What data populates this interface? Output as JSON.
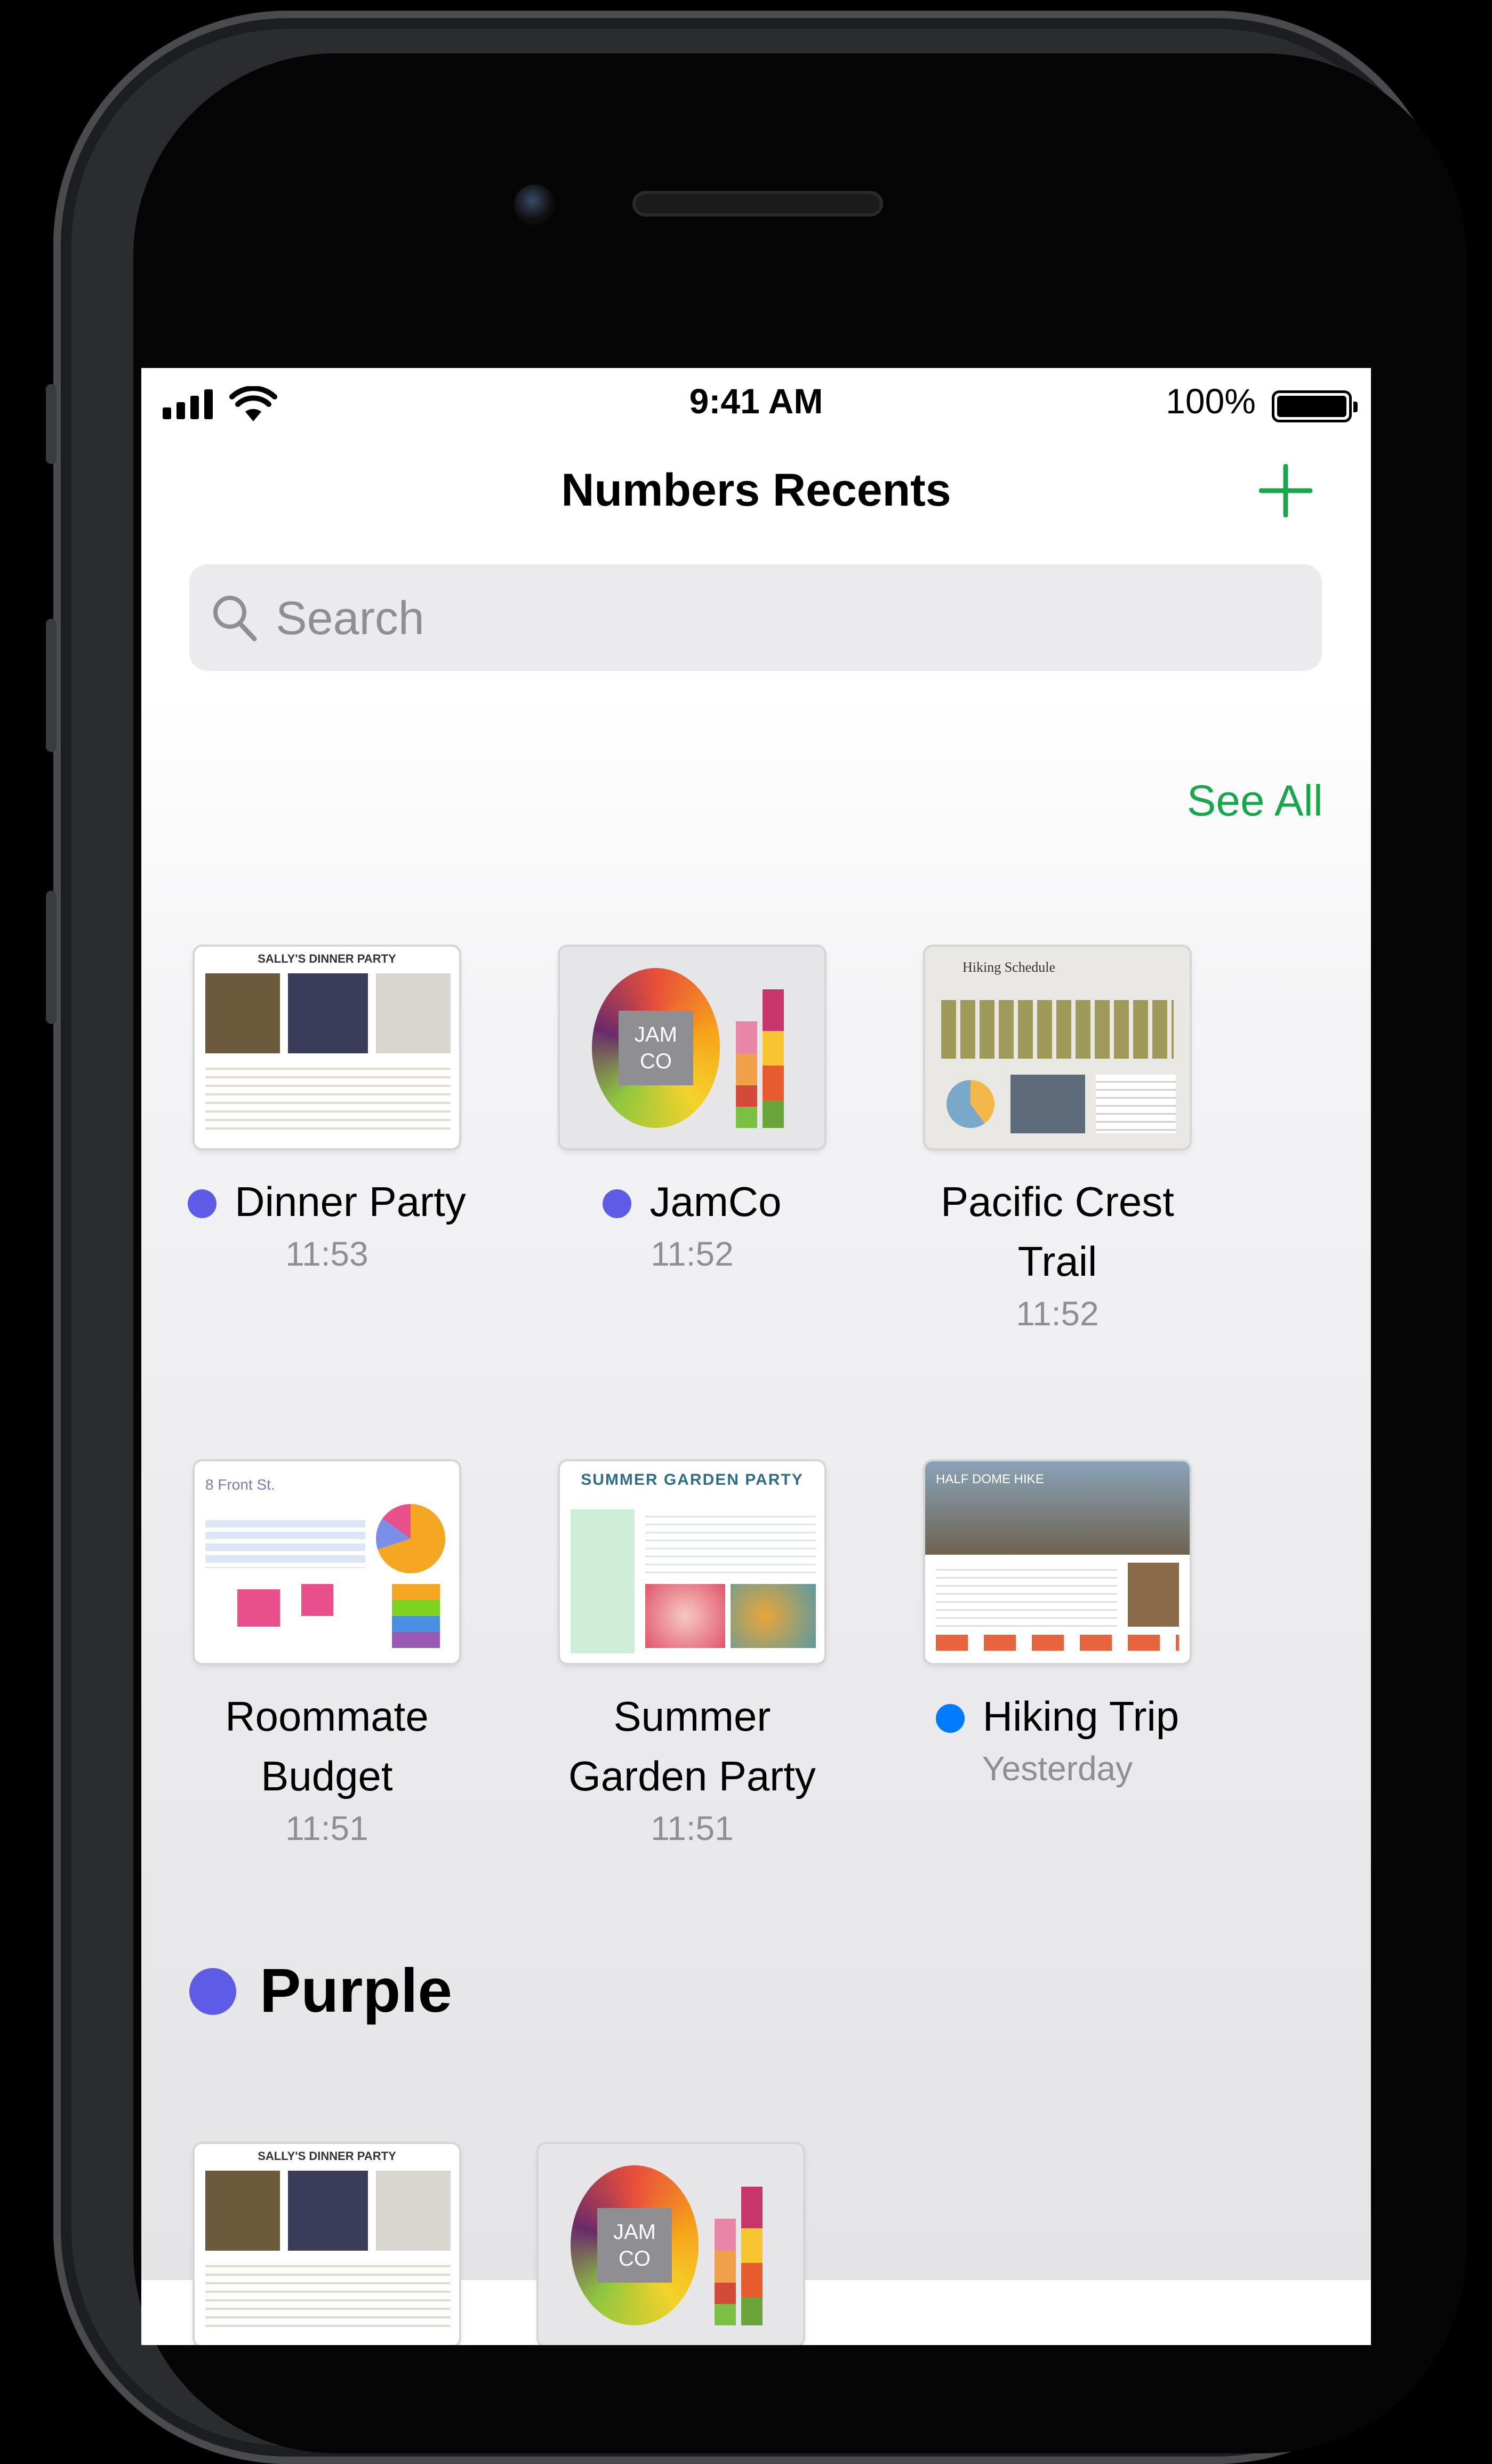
{
  "status_bar": {
    "time": "9:41 AM",
    "battery_percent": "100%"
  },
  "nav": {
    "title": "Numbers Recents"
  },
  "search": {
    "placeholder": "Search"
  },
  "recents": {
    "see_all_label": "See All",
    "documents": [
      {
        "name": "Dinner Party",
        "time": "11:53",
        "tag_color": "#5e5ce6",
        "thumb_title": "SALLY'S DINNER PARTY"
      },
      {
        "name": "JamCo",
        "time": "11:52",
        "tag_color": "#5e5ce6",
        "thumb_title": "JAM CO"
      },
      {
        "name_line1": "Pacific Crest",
        "name_line2": "Trail",
        "time": "11:52",
        "thumb_title": "Hiking Schedule"
      },
      {
        "name_line1": "Roommate",
        "name_line2": "Budget",
        "time": "11:51",
        "thumb_title": "8 Front St."
      },
      {
        "name_line1": "Summer",
        "name_line2": "Garden Party",
        "time": "11:51",
        "thumb_title": "SUMMER GARDEN PARTY"
      },
      {
        "name": "Hiking Trip",
        "time": "Yesterday",
        "tag_color": "#007aff",
        "thumb_title": "HALF DOME HIKE"
      }
    ]
  },
  "tag_section": {
    "label": "Purple",
    "color": "#5e5ce6"
  },
  "colors": {
    "accent": "#1aa64c",
    "purple_tag": "#5e5ce6",
    "blue_tag": "#007aff"
  },
  "icons": [
    "cellular-signal-icon",
    "wifi-icon",
    "battery-icon",
    "add-icon",
    "search-icon"
  ]
}
